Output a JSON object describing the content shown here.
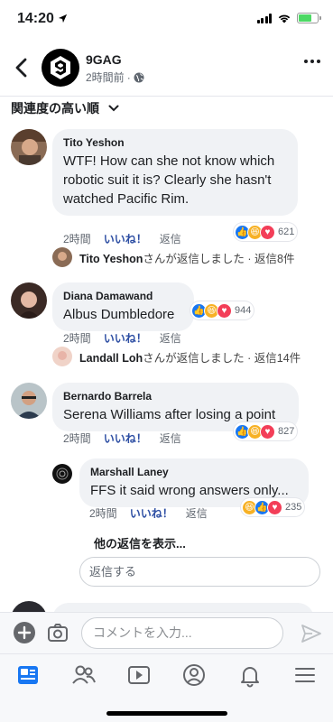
{
  "status_bar": {
    "time": "14:20"
  },
  "header": {
    "page_name": "9GAG",
    "timestamp": "2時間前",
    "logo_mark": "9"
  },
  "sort": {
    "label": "関連度の高い順"
  },
  "comments": [
    {
      "author": "Tito Yeshon",
      "text": "WTF! How can she not know which robotic suit it is? Clearly she hasn't watched Pacific Rim.",
      "time": "2時間",
      "like": "いいね！",
      "reply": "返信",
      "reaction_count": "621",
      "replies_name": "Tito Yeshon",
      "replies_text": "さんが返信しました · 返信8件"
    },
    {
      "author": "Diana Damawand",
      "text": "Albus Dumbledore",
      "time": "2時間",
      "like": "いいね！",
      "reply": "返信",
      "reaction_count": "944",
      "replies_name": "Landall Loh",
      "replies_text": "さんが返信しました · 返信14件"
    },
    {
      "author": "Bernardo Barrela",
      "text": "Serena Williams after losing a point",
      "time": "2時間",
      "like": "いいね！",
      "reply": "返信",
      "reaction_count": "827"
    }
  ],
  "nested_reply": {
    "author": "Marshall Laney",
    "text": "FFS it said wrong answers only...",
    "time": "2時間",
    "like": "いいね！",
    "reply": "返信",
    "reaction_count": "235"
  },
  "show_more_replies": "他の返信を表示...",
  "reply_placeholder": "返信する",
  "composer": {
    "placeholder": "コメントを入力..."
  },
  "colors": {
    "accent": "#1877f2",
    "like_text": "#2d4ea3",
    "bubble": "#f0f2f5",
    "battery": "#4cd964"
  },
  "icons": [
    "back-arrow-icon",
    "globe-icon",
    "more-icon",
    "chevron-down-icon",
    "plus-icon",
    "camera-icon",
    "send-icon",
    "news-feed-icon",
    "friends-icon",
    "watch-icon",
    "profile-icon",
    "notifications-icon",
    "menu-icon"
  ]
}
